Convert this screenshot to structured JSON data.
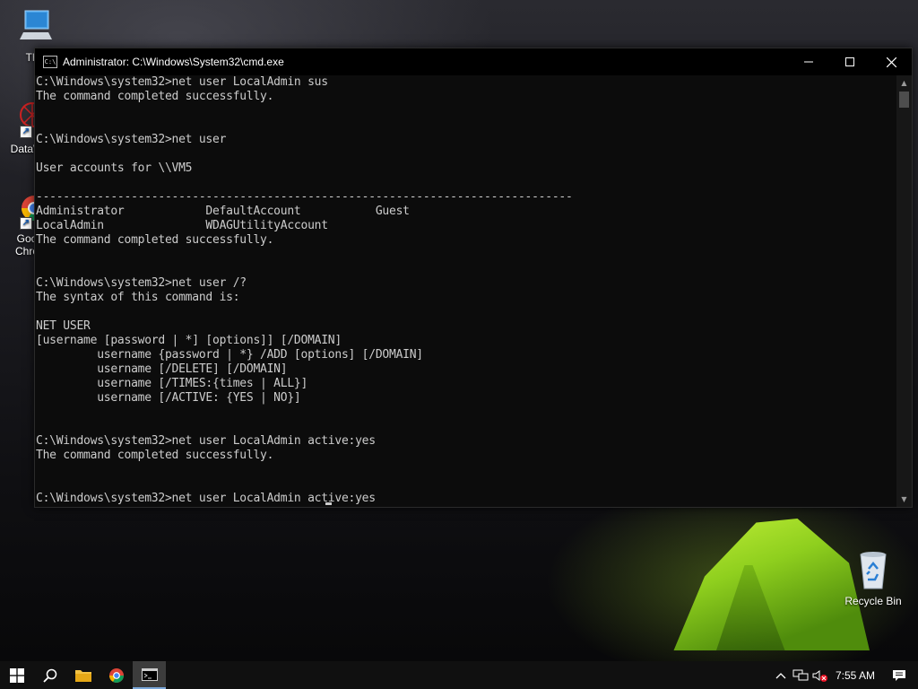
{
  "desktop": {
    "icons": [
      {
        "label": "This"
      },
      {
        "label": "DataW"
      },
      {
        "label": "Goo",
        "label2": "Chro"
      },
      {
        "label": "Recycle Bin"
      }
    ]
  },
  "window": {
    "title": "Administrator: C:\\Windows\\System32\\cmd.exe",
    "icon_text": "C:\\",
    "console_lines": [
      "C:\\Windows\\system32>net user LocalAdmin sus",
      "The command completed successfully.",
      "",
      "",
      "C:\\Windows\\system32>net user",
      "",
      "User accounts for \\\\VM5",
      "",
      "-------------------------------------------------------------------------------",
      "Administrator            DefaultAccount           Guest",
      "LocalAdmin               WDAGUtilityAccount",
      "The command completed successfully.",
      "",
      "",
      "C:\\Windows\\system32>net user /?",
      "The syntax of this command is:",
      "",
      "NET USER",
      "[username [password | *] [options]] [/DOMAIN]",
      "         username {password | *} /ADD [options] [/DOMAIN]",
      "         username [/DELETE] [/DOMAIN]",
      "         username [/TIMES:{times | ALL}]",
      "         username [/ACTIVE: {YES | NO}]",
      "",
      "",
      "C:\\Windows\\system32>net user LocalAdmin active:yes",
      "The command completed successfully.",
      "",
      "",
      "C:\\Windows\\system32>net user LocalAdmin active:yes"
    ]
  },
  "taskbar": {
    "clock": "7:55 AM",
    "accent_color": "#7aa6d8"
  }
}
